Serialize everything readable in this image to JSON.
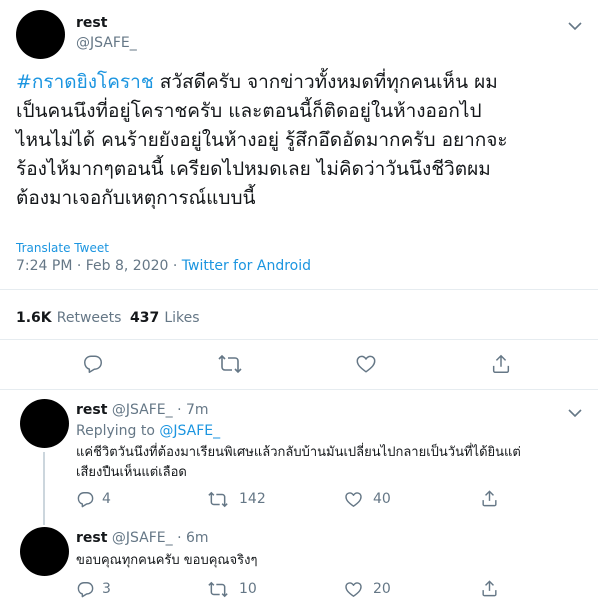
{
  "main_tweet": {
    "name": "rest",
    "handle": "@JSAFE_",
    "hashtag": "#กราดยิงโคราช",
    "text_lines": [
      " สวัสดีครับ จากข่าวทั้งหมดที่ทุกคนเห็น ผม",
      "เป็นคนนึงที่อยู่โคราชครับ และตอนนี้ก็ติดอยู่ในห้างออกไป",
      "ไหนไม่ได้ คนร้ายยังอยู่ในห้างอยู่ รู้สึกอึดอัดมากครับ อยากจะ",
      "ร้องไห้มากๆตอนนี้ เครียดไปหมดเลย ไม่คิดว่าวันนึงชีวิตผม",
      "ต้องมาเจอกับเหตุการณ์แบบนี้"
    ],
    "translate": "Translate Tweet",
    "time": "7:24 PM · Feb 8, 2020 · ",
    "source": "Twitter for Android",
    "retweets_count": "1.6K",
    "retweets_label": "Retweets",
    "likes_count": "437",
    "likes_label": "Likes"
  },
  "replies": [
    {
      "name": "rest",
      "handle_time": "@JSAFE_ · 7m",
      "replying_label": "Replying to ",
      "replying_to": "@JSAFE_",
      "text_lines": [
        "แค่ชีวิตวันนึงที่ต้องมาเรียนพิเศษแล้วกลับบ้านมันเปลี่ยนไปกลายเป็นวันที่ได้ยินแต่",
        "เสียงปืนเห็นแต่เลือด"
      ],
      "replies": "4",
      "retweets": "142",
      "likes": "40"
    },
    {
      "name": "rest",
      "handle_time": "@JSAFE_ · 6m",
      "text_lines": [
        "ขอบคุณทุกคนครับ ขอบคุณจริงๆ"
      ],
      "replies": "3",
      "retweets": "10",
      "likes": "20"
    }
  ],
  "icons": [
    "chevron-down-icon",
    "reply-icon",
    "retweet-icon",
    "like-icon",
    "share-icon"
  ],
  "colors": {
    "accent": "#1b95e0",
    "muted": "#657786",
    "divider": "#e6ecf0"
  }
}
